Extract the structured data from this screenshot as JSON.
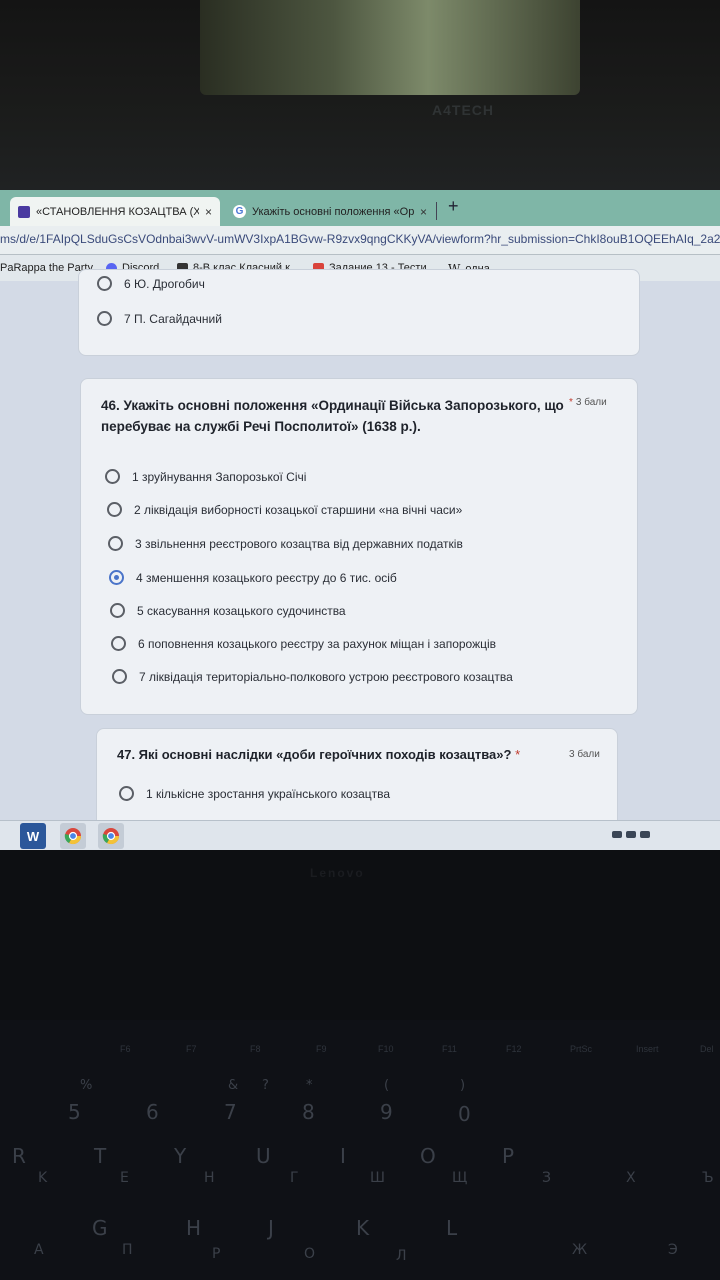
{
  "environment": {
    "monitor_brand": "A4TECH",
    "laptop_brand": "Lenovo"
  },
  "browser": {
    "tabs": [
      {
        "label": "«СТАНОВЛЕННЯ КОЗАЦТВА (XV",
        "icon": "google-forms-icon",
        "active": true
      },
      {
        "label": "Укажіть основні положення «Ор",
        "icon": "google-g-icon",
        "active": false
      }
    ],
    "new_tab": "+",
    "close": "×",
    "address": "ms/d/e/1FAIpQLSduGsCsVOdnbai3wvV-umWV3IxpA1BGvw-R9zvx9qngCKKyVA/viewform?hr_submission=ChkI8ouB1OQEEhAIq_2a2",
    "bookmarks": [
      {
        "label": "PaRappa the Party...",
        "icon": "bookmark-icon"
      },
      {
        "label": "Discord",
        "icon": "discord-icon"
      },
      {
        "label": "8-В клас Класний к...",
        "icon": "classroom-icon"
      },
      {
        "label": "Задание 13 - Тести...",
        "icon": "test-site-icon"
      },
      {
        "label": "одна",
        "icon": "wikipedia-icon",
        "glyph": "W"
      }
    ]
  },
  "form": {
    "prev_question": {
      "options": [
        "6 Ю. Дрогобич",
        "7 П. Сагайдачний"
      ]
    },
    "q46": {
      "title_line1": "46. Укажіть основні положення «Ординації Війська Запорозького, що",
      "title_line2": "перебуває на службі Речі Посполитої» (1638 р.).",
      "required": "*",
      "points": "3 бали",
      "options": [
        {
          "label": "1 зруйнування Запорозької Січі",
          "checked": false
        },
        {
          "label": "2 ліквідація виборності козацької старшини «на вічні часи»",
          "checked": false
        },
        {
          "label": "3 звільнення реєстрового козацтва від державних податків",
          "checked": false
        },
        {
          "label": "4 зменшення козацького реєстру до 6 тис. осіб",
          "checked": true
        },
        {
          "label": "5 скасування козацького судочинства",
          "checked": false
        },
        {
          "label": "6 поповнення козацького реєстру за рахунок міщан і запорожців",
          "checked": false
        },
        {
          "label": "7 ліквідація територіально-полкового устрою реєстрового козацтва",
          "checked": false
        }
      ]
    },
    "q47": {
      "title": "47. Які основні наслідки «доби героїчних походів козацтва»?",
      "required": "*",
      "points": "3 бали",
      "options": [
        "1 кількісне зростання українського козацтва"
      ]
    }
  },
  "taskbar": {
    "items": [
      {
        "icon": "word-icon",
        "glyph": "W"
      },
      {
        "icon": "chrome-icon"
      },
      {
        "icon": "chrome-profile-icon"
      }
    ]
  },
  "keyboard": {
    "fkeys": [
      "F6",
      "F7",
      "F8",
      "F9",
      "F10",
      "F11",
      "F12",
      "PrtSc",
      "Insert",
      "Del"
    ],
    "row1": [
      "%",
      "5",
      "6",
      "&",
      "?",
      "7",
      "*",
      "8",
      "(",
      "9",
      ")",
      "0"
    ],
    "row2": [
      "R",
      "K",
      "T",
      "E",
      "Y",
      "H",
      "U",
      "Г",
      "I",
      "Ш",
      "O",
      "Щ",
      "P",
      "З",
      "X",
      "Ъ"
    ],
    "row3": [
      "G",
      "H",
      "J",
      "K",
      "L",
      "Ж",
      "Э"
    ],
    "row4": [
      "A",
      "П",
      "P",
      "O",
      "Л"
    ]
  }
}
